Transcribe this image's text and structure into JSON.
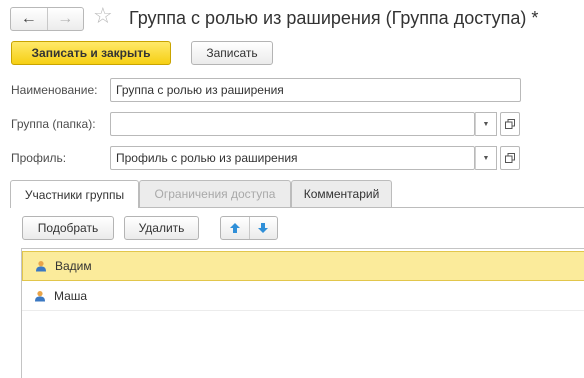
{
  "window": {
    "title": "Группа с ролью из раширения (Группа доступа) *"
  },
  "nav": {
    "back_label": "←",
    "forward_label": "→",
    "star_label": "☆"
  },
  "toolbar": {
    "save_close_label": "Записать и закрыть",
    "save_label": "Записать"
  },
  "form": {
    "name_label": "Наименование:",
    "name_value": "Группа с ролью из раширения",
    "group_label": "Группа (папка):",
    "group_value": "",
    "profile_label": "Профиль:",
    "profile_value": "Профиль с ролью из раширения"
  },
  "tabs": [
    {
      "label": "Участники группы",
      "state": "active"
    },
    {
      "label": "Ограничения доступа",
      "state": "disabled"
    },
    {
      "label": "Комментарий",
      "state": "normal"
    }
  ],
  "members_toolbar": {
    "pick_label": "Подобрать",
    "delete_label": "Удалить"
  },
  "members": [
    {
      "name": "Вадим",
      "selected": true
    },
    {
      "name": "Маша",
      "selected": false
    }
  ],
  "colors": {
    "primary_button": "#f6cf13",
    "selected_row": "#fbeb9b",
    "arrow_blue": "#2f8fd8"
  },
  "icons": {
    "user": "user-icon",
    "move_up": "arrow-up-icon",
    "move_down": "arrow-down-icon",
    "open": "open-form-icon",
    "dropdown": "dropdown-icon"
  }
}
